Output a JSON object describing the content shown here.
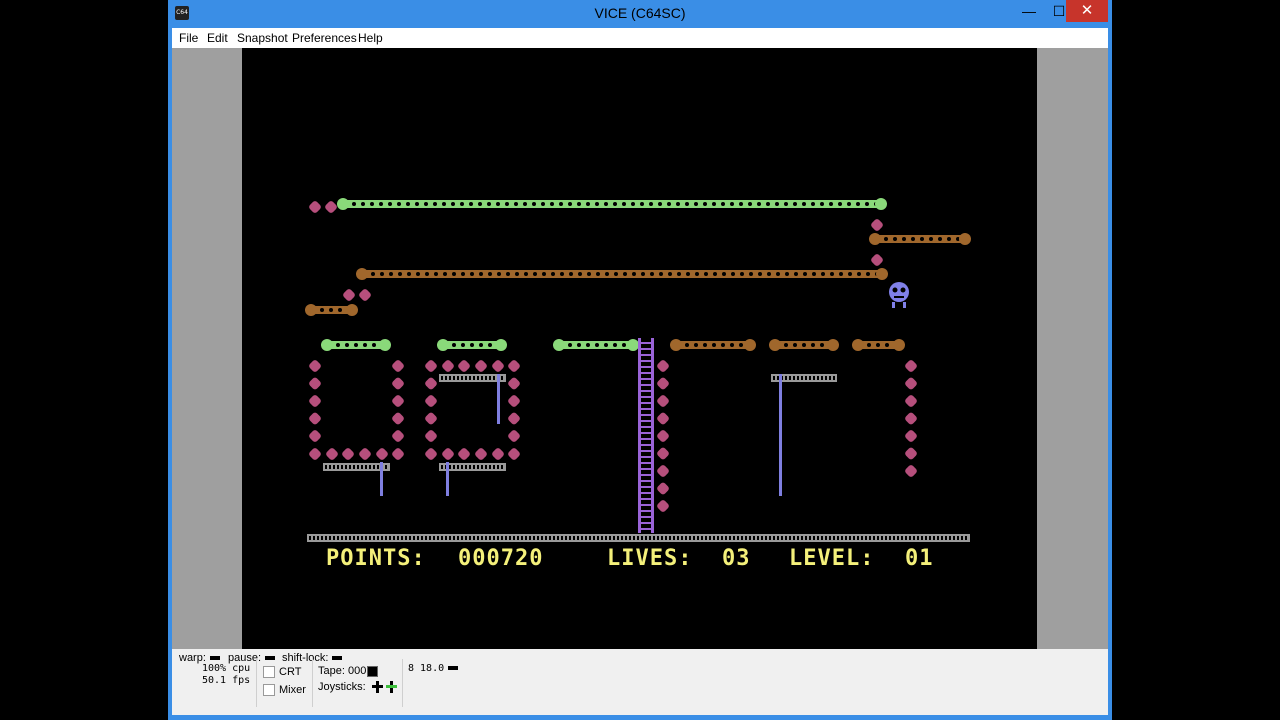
{
  "window": {
    "title": "VICE (C64SC)",
    "app_icon": "C64",
    "min_glyph": "—",
    "max_glyph": "☐",
    "close_glyph": "✕"
  },
  "menu": [
    "File",
    "Edit",
    "Snapshot",
    "Preferences",
    "Help"
  ],
  "status": {
    "warp_label": "warp:",
    "pause_label": "pause:",
    "shiftlock_label": "shift-lock:",
    "cpu": "100% cpu",
    "fps": "50.1 fps",
    "crt_label": "CRT",
    "mixer_label": "Mixer",
    "tape_label": "Tape:",
    "tape_counter": "000",
    "joysticks_label": "Joysticks:",
    "drive_status": "8 18.0"
  },
  "game": {
    "points_label": "POINTS:",
    "points_value": "000720",
    "lives_label": "LIVES:",
    "lives_value": "03",
    "level_label": "LEVEL:",
    "level_value": "01"
  },
  "colors": {
    "green_platform": "#8ad97a",
    "brown_platform": "#a0672c",
    "pink_collectible": "#b64f7c",
    "purple_ladder": "#9a63d8",
    "blue_rope": "#7f7fe0",
    "grey_girder": "#9a9a9a",
    "hud_yellow": "#f4f07a",
    "title_blue": "#3a8ee6"
  },
  "icons": [
    "c64-app-icon",
    "minimize-icon",
    "maximize-icon",
    "close-icon",
    "joystick-icon",
    "drive-led-icon"
  ]
}
